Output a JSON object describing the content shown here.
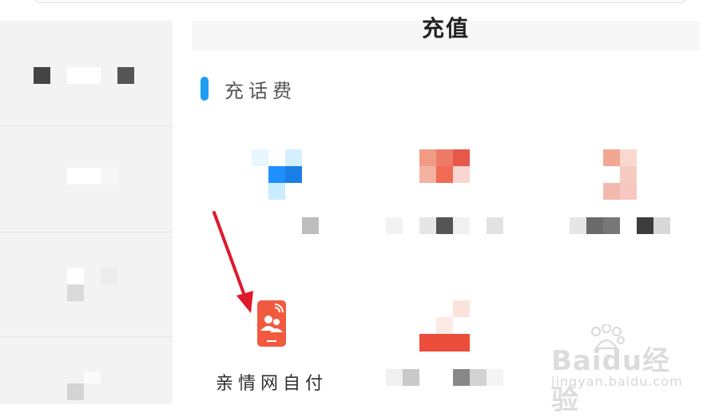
{
  "header": {
    "title": "充值"
  },
  "section": {
    "title": "充话费"
  },
  "grid": {
    "items": [
      {
        "label": "",
        "icon": "blue-app-icon"
      },
      {
        "label": "",
        "icon": "orange-app-icon"
      },
      {
        "label": "",
        "icon": "pink-app-icon"
      },
      {
        "label": "亲情网自付",
        "icon": "family-phone-icon"
      },
      {
        "label": "",
        "icon": "red-bar-icon"
      }
    ]
  },
  "watermark": {
    "main": "Baidu经验",
    "sub": "jingyan.baidu.com"
  },
  "colors": {
    "accent": "#1e9df3",
    "icon_red": "#f25a40",
    "arrow": "#e0192b",
    "sidebar_bg": "#f3f3f3"
  }
}
